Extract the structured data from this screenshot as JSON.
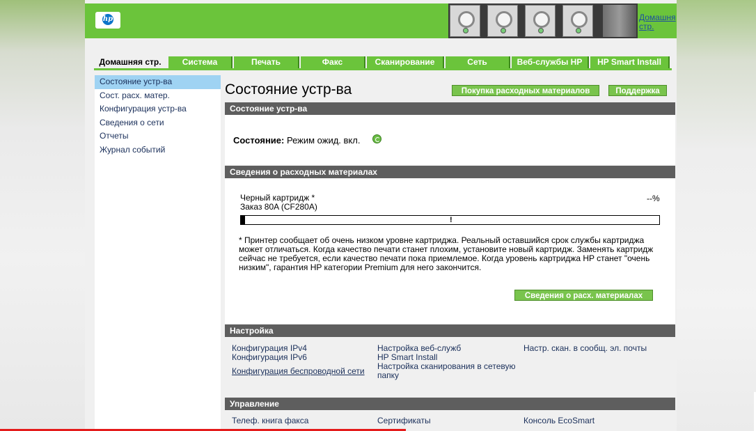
{
  "header": {
    "logo_text": "hp",
    "home_link": "Домашня стр."
  },
  "tabs": [
    {
      "label": "Домашняя стр.",
      "active": true
    },
    {
      "label": "Система"
    },
    {
      "label": "Печать"
    },
    {
      "label": "Факс"
    },
    {
      "label": "Сканирование"
    },
    {
      "label": "Сеть"
    },
    {
      "label": "Веб-службы HP"
    },
    {
      "label": "HP Smart Install"
    }
  ],
  "sidebar": {
    "items": [
      {
        "label": "Состояние устр-ва",
        "active": true
      },
      {
        "label": "Сост. расх. матер."
      },
      {
        "label": "Конфигурация устр-ва"
      },
      {
        "label": "Сведения о сети"
      },
      {
        "label": "Отчеты"
      },
      {
        "label": "Журнал событий"
      }
    ]
  },
  "main": {
    "title": "Состояние устр-ва",
    "buttons": {
      "buy_supplies": "Покупка расходных материалов",
      "support": "Поддержка"
    },
    "status_section": {
      "header": "Состояние устр-ва",
      "label": "Состояние:",
      "value": "Режим ожид. вкл."
    },
    "supplies_section": {
      "header": "Сведения о расходных материалах",
      "cartridge_name": "Черный картридж *",
      "order": "Заказ 80A (CF280A)",
      "percent": "--%",
      "level_fraction": 0.01,
      "bar_marker": "!",
      "note": "* Принтер сообщает об очень низком уровне картриджа. Реальный оставшийся срок службы картриджа может отличаться. Когда качество печати станет плохим, установите новый картридж. Заменять картридж сейчас не требуется, если качество печати пока приемлемое. Когда уровень картриджа HP станет \"очень низким\", гарантия HP категории Premium для него закончится.",
      "details_button": "Сведения о расх. материалах"
    },
    "setup_section": {
      "header": "Настройка",
      "col1": [
        "Конфигурация IPv4",
        "Конфигурация IPv6",
        "Конфигурация беспроводной сети"
      ],
      "col2": [
        "Настройка веб-служб",
        "HP Smart Install",
        "Настройка сканирования в сетевую папку"
      ],
      "col3": [
        "Настр. скан. в сообщ. эл. почты"
      ]
    },
    "management_section": {
      "header": "Управление",
      "col1": [
        "Телеф. книга факса"
      ],
      "col2": [
        "Сертификаты"
      ],
      "col3": [
        "Консоль EcoSmart"
      ]
    }
  },
  "colors": {
    "hp_green": "#6bc43b",
    "section_gray": "#5e5e5e",
    "sidebar_active": "#9fd3f3",
    "link_blue": "#1a2f5a"
  }
}
